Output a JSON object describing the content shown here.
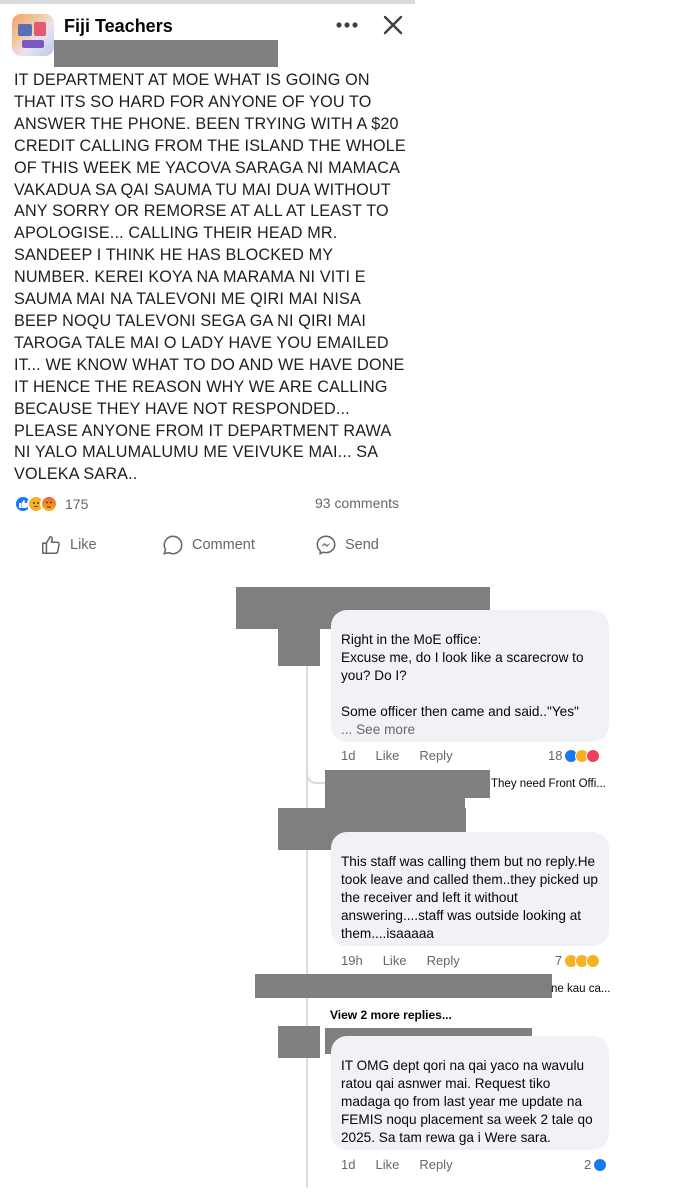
{
  "header": {
    "group_name": "Fiji Teachers",
    "more_icon": "more-horizontal-icon",
    "close_icon": "close-icon"
  },
  "post": {
    "text": "IT DEPARTMENT AT MOE WHAT IS GOING ON\nTHAT ITS SO HARD FOR ANYONE OF YOU TO\nANSWER THE PHONE. BEEN TRYING WITH A $20\nCREDIT CALLING FROM THE ISLAND THE WHOLE\nOF THIS WEEK ME YACOVA SARAGA NI MAMACA\nVAKADUA SA QAI SAUMA TU MAI DUA WITHOUT\nANY SORRY OR REMORSE AT ALL AT LEAST TO\nAPOLOGISE... CALLING THEIR HEAD MR.\nSANDEEP I THINK HE HAS BLOCKED MY\nNUMBER. KEREI KOYA NA MARAMA NI VITI E\nSAUMA MAI NA TALEVONI ME QIRI MAI NISA\nBEEP NOQU TALEVONI SEGA GA NI QIRI MAI\nTAROGA TALE MAI O LADY HAVE YOU EMAILED\nIT... WE KNOW WHAT TO DO AND WE HAVE DONE\nIT HENCE THE REASON WHY WE ARE CALLING\nBECAUSE THEY HAVE NOT RESPONDED...\nPLEASE ANYONE FROM IT DEPARTMENT RAWA\nNI YALO MALUMALUMU ME VEIVUKE MAI... SA\nVOLEKA SARA..",
    "reaction_count": "175",
    "comment_count": "93 comments",
    "reaction_icons": [
      "like-icon",
      "sad-icon",
      "angry-icon"
    ]
  },
  "actions": {
    "like": "Like",
    "comment": "Comment",
    "send": "Send"
  },
  "comments": [
    {
      "text": "Right in the MoE office:\nExcuse me, do I look like a scarecrow to you? Do I?\n\nSome officer then came and said..\"Yes\"",
      "see_more": "... See more",
      "time": "1d",
      "like": "Like",
      "reply": "Reply",
      "reactions": "18",
      "reaction_icons": [
        "like-icon",
        "haha-icon",
        "love-icon"
      ]
    },
    {
      "snippet": "They need Front Offi..."
    },
    {
      "text": "This staff was calling them but no reply.He took leave and called them..they picked up the receiver and left it without answering....staff was outside looking at them....isaaaaa",
      "time": "19h",
      "like": "Like",
      "reply": "Reply",
      "reactions": "7",
      "reaction_icons": [
        "wow-icon",
        "haha-icon",
        "sad-icon"
      ]
    },
    {
      "snippet": "ne kau ca..."
    },
    {
      "view_more": "View 2 more replies..."
    },
    {
      "text": "IT OMG dept qori na qai yaco na wavulu ratou qai asnwer mai. Request tiko madaga qo from last year me update na FEMIS noqu placement sa week 2 tale qo 2025. Sa tam rewa ga i Were sara.",
      "time": "1d",
      "like": "Like",
      "reply": "Reply",
      "reactions": "2",
      "reaction_icons": [
        "like-icon"
      ]
    }
  ],
  "colors": {
    "fb_blue": "#1877f2",
    "secondary_text": "#65676b",
    "bubble_bg": "#f0f2f5",
    "redaction": "#7f7f7f"
  }
}
